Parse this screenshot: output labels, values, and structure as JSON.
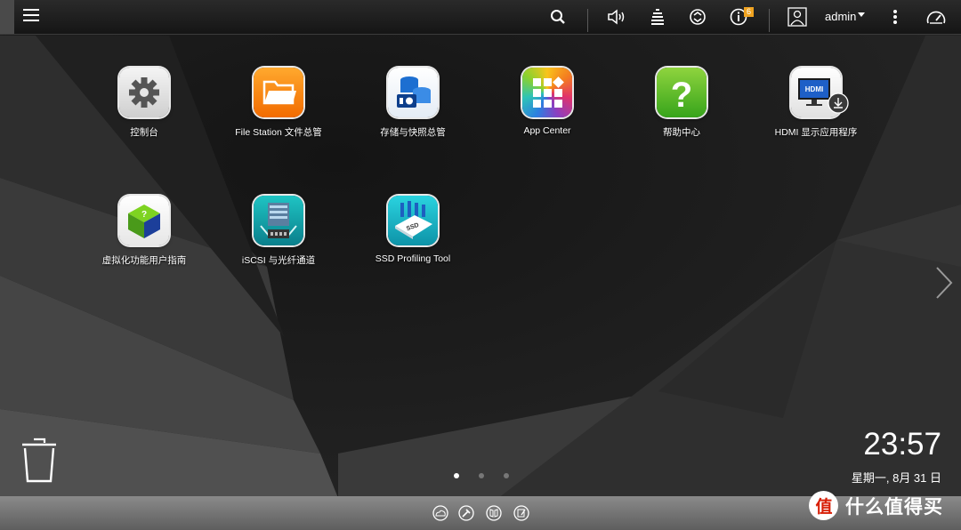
{
  "topbar": {
    "user_name": "admin",
    "notification_count": "6",
    "icons": [
      "menu-icon",
      "search-icon",
      "volume-icon",
      "event-log-icon",
      "sync-icon",
      "info-icon",
      "user-avatar-icon",
      "more-vert-icon",
      "dashboard-icon"
    ]
  },
  "apps": [
    {
      "label": "控制台",
      "icon": "gear-icon"
    },
    {
      "label": "File Station 文件总管",
      "icon": "folder-icon"
    },
    {
      "label": "存储与快照总管",
      "icon": "storage-icon"
    },
    {
      "label": "App Center",
      "icon": "app-grid-icon"
    },
    {
      "label": "帮助中心",
      "icon": "help-icon"
    },
    {
      "label": "HDMI 显示应用程序",
      "icon": "hdmi-monitor-icon"
    },
    {
      "label": "虚拟化功能用户指南",
      "icon": "virtualization-cube-icon"
    },
    {
      "label": "iSCSI 与光纤通道",
      "icon": "iscsi-server-icon"
    },
    {
      "label": "SSD Profiling Tool",
      "icon": "ssd-icon"
    }
  ],
  "clock": {
    "time": "23:57",
    "date": "星期一, 8月 31 日"
  },
  "pager": {
    "pages": 3,
    "active": 1
  },
  "watermark": {
    "glyph": "值",
    "text": "什么值得买"
  },
  "colors": {
    "badge": "#f0a320",
    "topbar": "#1e1e1e",
    "dock": "#707070"
  }
}
